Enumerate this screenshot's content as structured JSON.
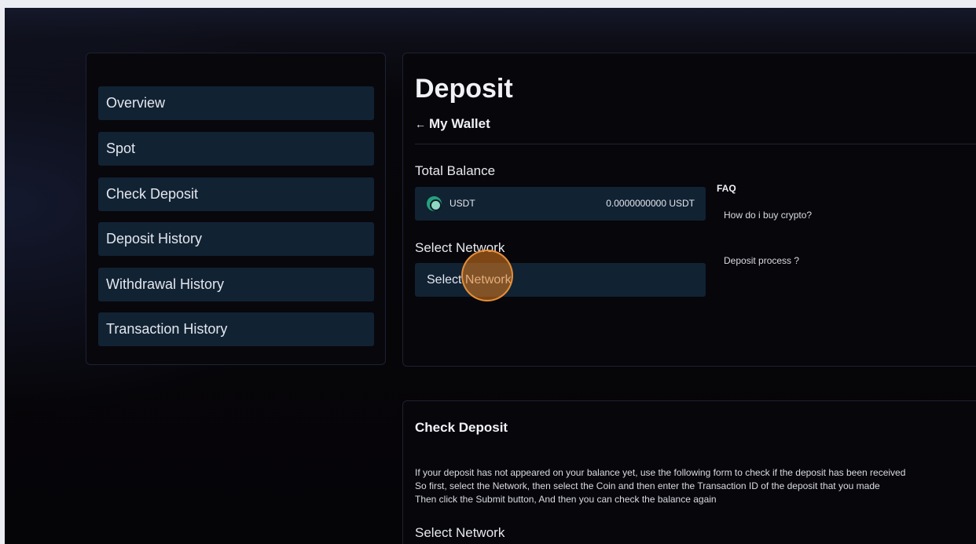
{
  "sidebar": {
    "items": [
      {
        "label": "Overview"
      },
      {
        "label": "Spot"
      },
      {
        "label": "Check Deposit"
      },
      {
        "label": "Deposit History"
      },
      {
        "label": "Withdrawal History"
      },
      {
        "label": "Transaction History"
      }
    ]
  },
  "deposit": {
    "title": "Deposit",
    "back_arrow": "←",
    "back_label": "My Wallet",
    "total_balance_label": "Total Balance",
    "balance": {
      "coin_icon": "usdt-coin-icon",
      "coin": "USDT",
      "amount": "0.0000000000 USDT"
    },
    "select_network_label": "Select Network",
    "select_network_placeholder": "Select Network"
  },
  "faq": {
    "title": "FAQ",
    "items": [
      {
        "label": "How do i buy crypto?"
      },
      {
        "label": "Deposit process ?"
      }
    ]
  },
  "check_deposit": {
    "title": "Check Deposit",
    "lines": [
      "If your deposit has not appeared on your balance yet, use the following form to check if the deposit has been received",
      "So first, select the Network, then select the Coin and then enter the Transaction ID of the deposit that you made",
      "Then click the Submit button, And then you can check the balance again"
    ],
    "select_network_label": "Select Network"
  },
  "colors": {
    "item_background": "#112233",
    "page_background": "#07060a",
    "click_indicator": "#e07c1e"
  }
}
